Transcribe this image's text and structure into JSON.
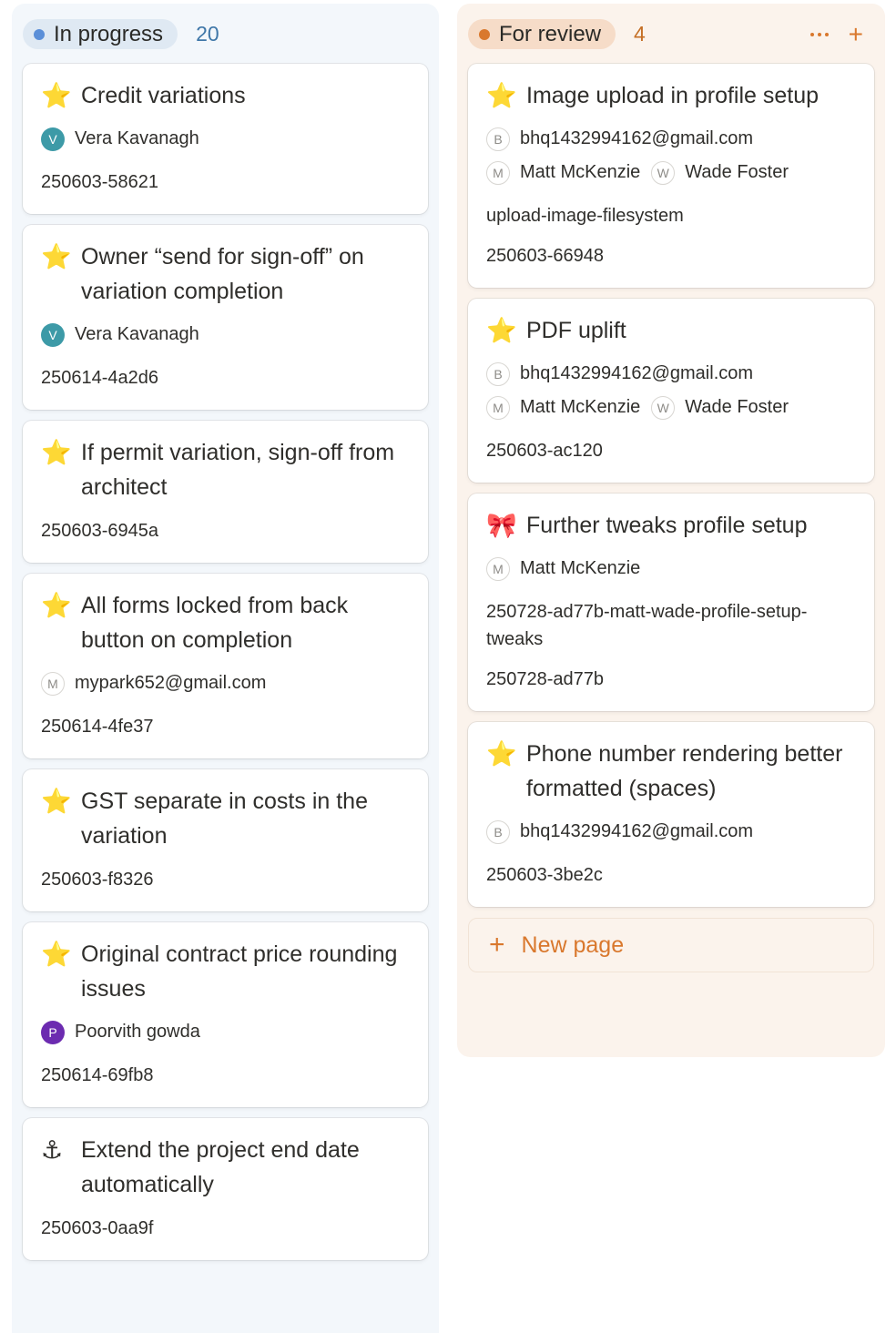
{
  "columns": [
    {
      "status": "In progress",
      "count": "20",
      "dot_color": "#5b8fd8",
      "cards": [
        {
          "icon": "⭐",
          "title": "Credit variations",
          "people": [
            {
              "initial": "V",
              "name": "Vera Kavanagh",
              "style": "teal"
            }
          ],
          "text": "",
          "id": "250603-58621"
        },
        {
          "icon": "⭐",
          "title": "Owner “send for sign-off” on variation completion",
          "people": [
            {
              "initial": "V",
              "name": "Vera Kavanagh",
              "style": "teal"
            }
          ],
          "text": "",
          "id": "250614-4a2d6"
        },
        {
          "icon": "⭐",
          "title": "If permit variation, sign-off from architect",
          "people": [],
          "text": "",
          "id": "250603-6945a"
        },
        {
          "icon": "⭐",
          "title": "All forms locked from back button on completion",
          "people": [
            {
              "initial": "M",
              "name": "mypark652@gmail.com",
              "style": "outline"
            }
          ],
          "text": "",
          "id": "250614-4fe37"
        },
        {
          "icon": "⭐",
          "title": "GST separate in costs in the variation",
          "people": [],
          "text": "",
          "id": "250603-f8326"
        },
        {
          "icon": "⭐",
          "title": "Original contract price rounding issues",
          "people": [
            {
              "initial": "P",
              "name": "Poorvith gowda",
              "style": "purple"
            }
          ],
          "text": "",
          "id": "250614-69fb8"
        },
        {
          "icon": "⚓",
          "title": "Extend the project end date automatically",
          "people": [],
          "text": "",
          "id": "250603-0aa9f"
        }
      ]
    },
    {
      "status": "For review",
      "count": "4",
      "dot_color": "#d9782d",
      "cards": [
        {
          "icon": "⭐",
          "title": "Image upload in profile setup",
          "people_rows": [
            [
              {
                "initial": "B",
                "name": "bhq1432994162@gmail.com",
                "style": "outline"
              }
            ],
            [
              {
                "initial": "M",
                "name": "Matt McKenzie",
                "style": "outline"
              },
              {
                "initial": "W",
                "name": "Wade Foster",
                "style": "outline"
              }
            ]
          ],
          "text": "upload-image-filesystem",
          "id": "250603-66948"
        },
        {
          "icon": "⭐",
          "title": "PDF uplift",
          "people_rows": [
            [
              {
                "initial": "B",
                "name": "bhq1432994162@gmail.com",
                "style": "outline"
              }
            ],
            [
              {
                "initial": "M",
                "name": "Matt McKenzie",
                "style": "outline"
              },
              {
                "initial": "W",
                "name": "Wade Foster",
                "style": "outline"
              }
            ]
          ],
          "text": "",
          "id": "250603-ac120"
        },
        {
          "icon": "🎀",
          "title": "Further tweaks profile setup",
          "people_rows": [
            [
              {
                "initial": "M",
                "name": "Matt McKenzie",
                "style": "outline"
              }
            ]
          ],
          "text": "250728-ad77b-matt-wade-profile-setup-tweaks",
          "id": "250728-ad77b"
        },
        {
          "icon": "⭐",
          "title": "Phone number rendering better formatted (spaces)",
          "people_rows": [
            [
              {
                "initial": "B",
                "name": "bhq1432994162@gmail.com",
                "style": "outline"
              }
            ]
          ],
          "text": "",
          "id": "250603-3be2c"
        }
      ],
      "new_page_label": "New page"
    }
  ]
}
